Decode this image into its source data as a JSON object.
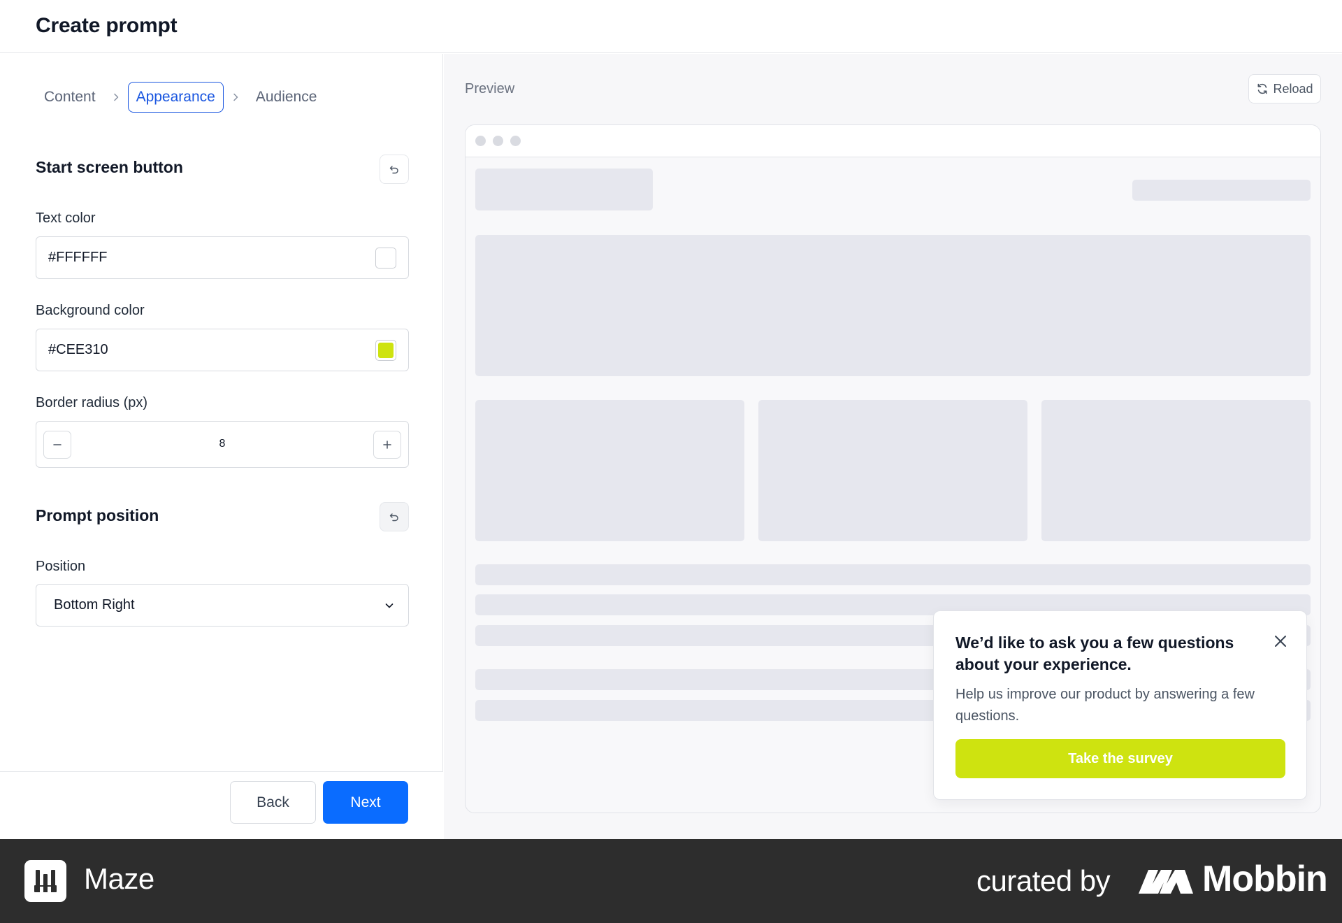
{
  "header": {
    "title": "Create prompt"
  },
  "steps": [
    {
      "label": "Content",
      "active": false
    },
    {
      "label": "Appearance",
      "active": true
    },
    {
      "label": "Audience",
      "active": false
    }
  ],
  "start_screen_button": {
    "title": "Start screen button",
    "text_color": {
      "label": "Text color",
      "value": "#FFFFFF",
      "swatch": "#FFFFFF"
    },
    "background_color": {
      "label": "Background color",
      "value": "#CEE310",
      "swatch": "#CEE310"
    },
    "border_radius": {
      "label": "Border radius (px)",
      "value": "8"
    }
  },
  "prompt_position": {
    "title": "Prompt position",
    "position_label": "Position",
    "position_value": "Bottom Right"
  },
  "footer": {
    "back_label": "Back",
    "next_label": "Next"
  },
  "preview": {
    "title": "Preview",
    "reload_label": "Reload",
    "survey": {
      "question": "We’d like to ask you a few questions about your experience.",
      "description": "Help us improve our product by answering a few questions.",
      "cta_label": "Take the survey",
      "cta_color": "#CEE310"
    }
  },
  "brand": {
    "app_name": "Maze",
    "curated_by": "curated by",
    "curator": "Mobbin"
  },
  "colors": {
    "accent": "#0A6CFF",
    "step_active": "#1A56E0",
    "skeleton": "#E6E7EE"
  }
}
